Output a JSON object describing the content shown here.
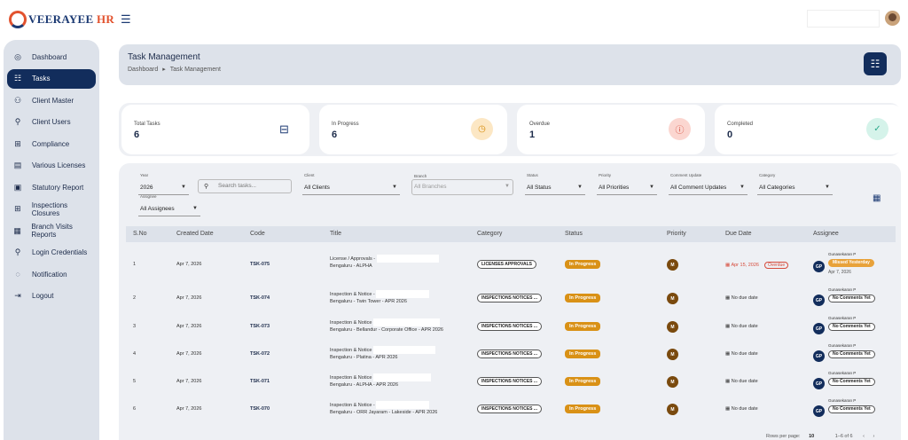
{
  "brand": {
    "name_main": "VEERAYEE",
    "name_hr": "HR"
  },
  "sidebar": {
    "items": [
      {
        "label": "Dashboard",
        "icon": "dashboard-icon"
      },
      {
        "label": "Tasks",
        "icon": "tasks-icon"
      },
      {
        "label": "Client Master",
        "icon": "users-icon"
      },
      {
        "label": "Client Users",
        "icon": "user-key-icon"
      },
      {
        "label": "Compliance",
        "icon": "compliance-icon"
      },
      {
        "label": "Various Licenses",
        "icon": "license-icon"
      },
      {
        "label": "Statutory Report",
        "icon": "report-icon"
      },
      {
        "label": "Inspections Closures",
        "icon": "inspection-icon"
      },
      {
        "label": "Branch Visits Reports",
        "icon": "branch-icon"
      },
      {
        "label": "Login Credentials",
        "icon": "key-icon"
      },
      {
        "label": "Notification",
        "icon": "chat-icon"
      },
      {
        "label": "Logout",
        "icon": "logout-icon"
      }
    ]
  },
  "header": {
    "title": "Task Management",
    "crumb_home": "Dashboard",
    "crumb_sep": "▸",
    "crumb_current": "Task Management"
  },
  "stats": [
    {
      "label": "Total Tasks",
      "value": "6",
      "color": "#1c3a73",
      "bg": "#ffffff",
      "glyph": "⊟"
    },
    {
      "label": "In Progress",
      "value": "6",
      "color": "#d99116",
      "bg": "#fce7c4",
      "glyph": "◷"
    },
    {
      "label": "Overdue",
      "value": "1",
      "color": "#d64a3a",
      "bg": "#fbd6d0",
      "glyph": "ⓘ"
    },
    {
      "label": "Completed",
      "value": "0",
      "color": "#2aa88a",
      "bg": "#d5f3ea",
      "glyph": "✓"
    }
  ],
  "filters": {
    "year": {
      "label": "Year",
      "value": "2026"
    },
    "search": {
      "placeholder": "Search tasks..."
    },
    "client": {
      "label": "Client",
      "value": "All Clients"
    },
    "branch": {
      "label": "Branch",
      "value": "All Branches"
    },
    "status": {
      "label": "Status",
      "value": "All Status"
    },
    "priority": {
      "label": "Priority",
      "value": "All Priorities"
    },
    "comment": {
      "label": "Comment Update",
      "value": "All Comment Updates"
    },
    "category": {
      "label": "Category",
      "value": "All Categories"
    },
    "assignee": {
      "label": "Assignee",
      "value": "All Assignees"
    }
  },
  "table": {
    "headers": [
      "S.No",
      "Created Date",
      "Code",
      "Title",
      "Category",
      "Status",
      "Priority",
      "Due Date",
      "Assignee"
    ],
    "rows": [
      {
        "sno": "1",
        "created": "Apr 7, 2026",
        "code": "TSK-075",
        "title1": "License / Approvals -",
        "title2": "Bengaluru - ALPHA",
        "category": "LICENSES APPROVALS",
        "status": "In Progress",
        "priority": "M",
        "due": "Apr 15, 2026",
        "overdue": "Overdue",
        "assignee": "Gunasekaran P",
        "initials": "GP",
        "comment": "Missed Yesterday",
        "comment_date": "Apr 7, 2026"
      },
      {
        "sno": "2",
        "created": "Apr 7, 2026",
        "code": "TSK-074",
        "title1": "Inspection & Notice -",
        "title2": "Bengaluru - Twin Tower - APR 2026",
        "category": "INSPECTIONS NOTICES ...",
        "status": "In Progress",
        "priority": "M",
        "due": "No due date",
        "overdue": "",
        "assignee": "Gunasekaran P",
        "initials": "GP",
        "comment": "No Comments Yet",
        "comment_date": ""
      },
      {
        "sno": "3",
        "created": "Apr 7, 2026",
        "code": "TSK-073",
        "title1": "Inspection & Notice",
        "title2": "Bengaluru - Bellandur - Corporate Office - APR 2026",
        "category": "INSPECTIONS NOTICES ...",
        "status": "In Progress",
        "priority": "M",
        "due": "No due date",
        "overdue": "",
        "assignee": "Gunasekaran P",
        "initials": "GP",
        "comment": "No Comments Yet",
        "comment_date": ""
      },
      {
        "sno": "4",
        "created": "Apr 7, 2026",
        "code": "TSK-072",
        "title1": "Inspection & Notice",
        "title2": "Bengaluru - Platina - APR 2026",
        "category": "INSPECTIONS NOTICES ...",
        "status": "In Progress",
        "priority": "M",
        "due": "No due date",
        "overdue": "",
        "assignee": "Gunasekaran P",
        "initials": "GP",
        "comment": "No Comments Yet",
        "comment_date": ""
      },
      {
        "sno": "5",
        "created": "Apr 7, 2026",
        "code": "TSK-071",
        "title1": "Inspection & Notice",
        "title2": "Bengaluru - ALPHA - APR 2026",
        "category": "INSPECTIONS NOTICES ...",
        "status": "In Progress",
        "priority": "M",
        "due": "No due date",
        "overdue": "",
        "assignee": "Gunasekaran P",
        "initials": "GP",
        "comment": "No Comments Yet",
        "comment_date": ""
      },
      {
        "sno": "6",
        "created": "Apr 7, 2026",
        "code": "TSK-070",
        "title1": "Inspection & Notice -",
        "title2": "Bengaluru - ORR Jayaram - Lakeside - APR 2026",
        "category": "INSPECTIONS NOTICES ...",
        "status": "In Progress",
        "priority": "M",
        "due": "No due date",
        "overdue": "",
        "assignee": "Gunasekaran P",
        "initials": "GP",
        "comment": "No Comments Yet",
        "comment_date": ""
      }
    ]
  },
  "pager": {
    "rows_label": "Rows per page:",
    "rows_value": "10",
    "range": "1–6 of 6"
  }
}
